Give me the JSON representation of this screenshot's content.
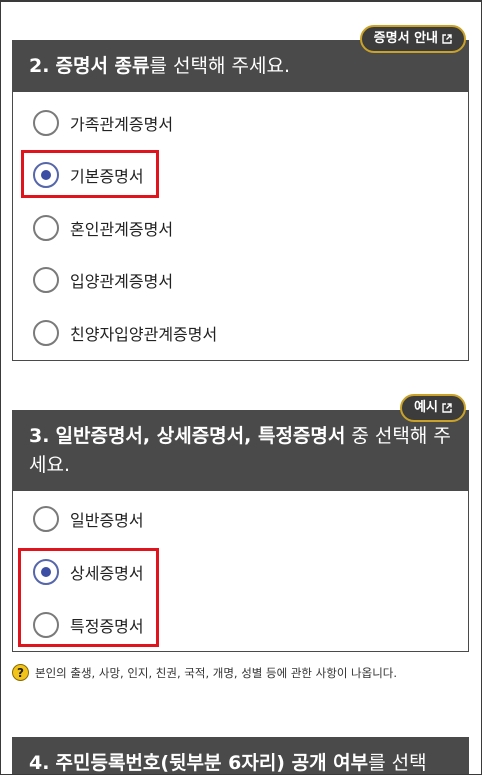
{
  "section2": {
    "badge_label": "증명서 안내",
    "number": "2.",
    "title_bold": "증명서 종류",
    "title_rest": "를 선택해 주세요.",
    "options": [
      {
        "label": "가족관계증명서",
        "selected": false
      },
      {
        "label": "기본증명서",
        "selected": true
      },
      {
        "label": "혼인관계증명서",
        "selected": false
      },
      {
        "label": "입양관계증명서",
        "selected": false
      },
      {
        "label": "친양자입양관계증명서",
        "selected": false
      }
    ]
  },
  "section3": {
    "badge_label": "예시",
    "number": "3.",
    "title_bold": "일반증명서, 상세증명서, 특정증명서",
    "title_rest": " 중 선택해 주세요.",
    "options": [
      {
        "label": "일반증명서",
        "selected": false
      },
      {
        "label": "상세증명서",
        "selected": true
      },
      {
        "label": "특정증명서",
        "selected": false
      }
    ],
    "note": "본인의 출생, 사망, 인지, 친권, 국적, 개명, 성별 등에 관한 사항이 나옵니다."
  },
  "section4": {
    "number": "4.",
    "title_bold": "주민등록번호(뒷부분 6자리) 공개 여부",
    "title_rest": "를 선택"
  },
  "colors": {
    "header_bg": "#4a4a4a",
    "badge_border": "#c9a227",
    "radio_selected": "#3b4ea3",
    "highlight": "#e0141c",
    "help_icon": "#f2c318"
  },
  "icons": {
    "external": "external-link-icon",
    "help": "question-icon"
  }
}
